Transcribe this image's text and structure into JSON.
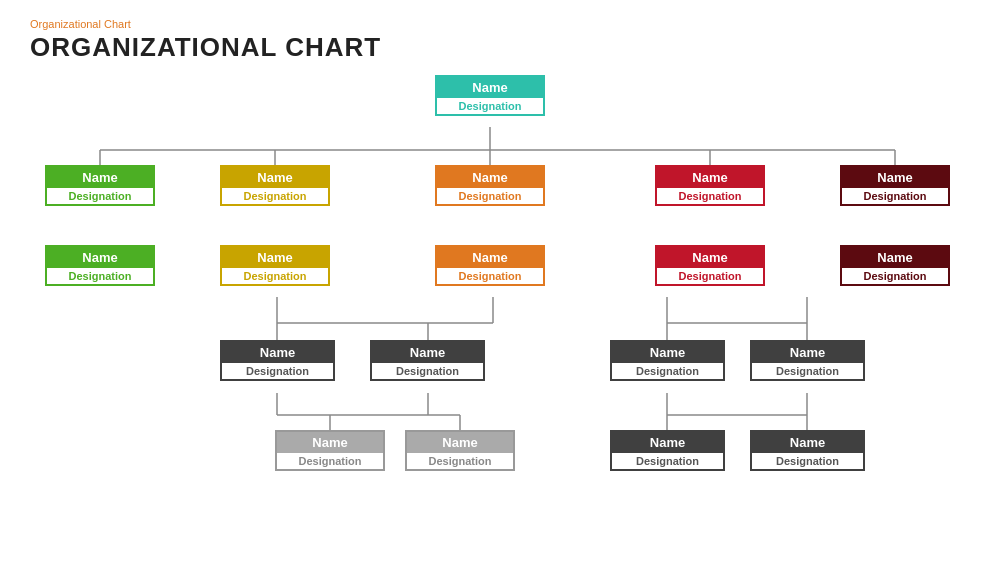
{
  "header": {
    "subtitle": "Organizational  Chart",
    "title": "ORGANIZATIONAL CHART"
  },
  "nodes": {
    "root": {
      "name": "Name",
      "desig": "Designation"
    },
    "l1_1": {
      "name": "Name",
      "desig": "Designation"
    },
    "l1_2": {
      "name": "Name",
      "desig": "Designation"
    },
    "l1_3": {
      "name": "Name",
      "desig": "Designation"
    },
    "l1_4": {
      "name": "Name",
      "desig": "Designation"
    },
    "l1_5": {
      "name": "Name",
      "desig": "Designation"
    },
    "l2_1": {
      "name": "Name",
      "desig": "Designation"
    },
    "l2_2": {
      "name": "Name",
      "desig": "Designation"
    },
    "l2_3": {
      "name": "Name",
      "desig": "Designation"
    },
    "l2_4": {
      "name": "Name",
      "desig": "Designation"
    },
    "l2_5": {
      "name": "Name",
      "desig": "Designation"
    },
    "l3_1": {
      "name": "Name",
      "desig": "Designation"
    },
    "l3_2": {
      "name": "Name",
      "desig": "Designation"
    },
    "l3_3": {
      "name": "Name",
      "desig": "Designation"
    },
    "l3_4": {
      "name": "Name",
      "desig": "Designation"
    },
    "l4_1": {
      "name": "Name",
      "desig": "Designation"
    },
    "l4_2": {
      "name": "Name",
      "desig": "Designation"
    },
    "l4_3": {
      "name": "Name",
      "desig": "Designation"
    },
    "l4_4": {
      "name": "Name",
      "desig": "Designation"
    }
  }
}
